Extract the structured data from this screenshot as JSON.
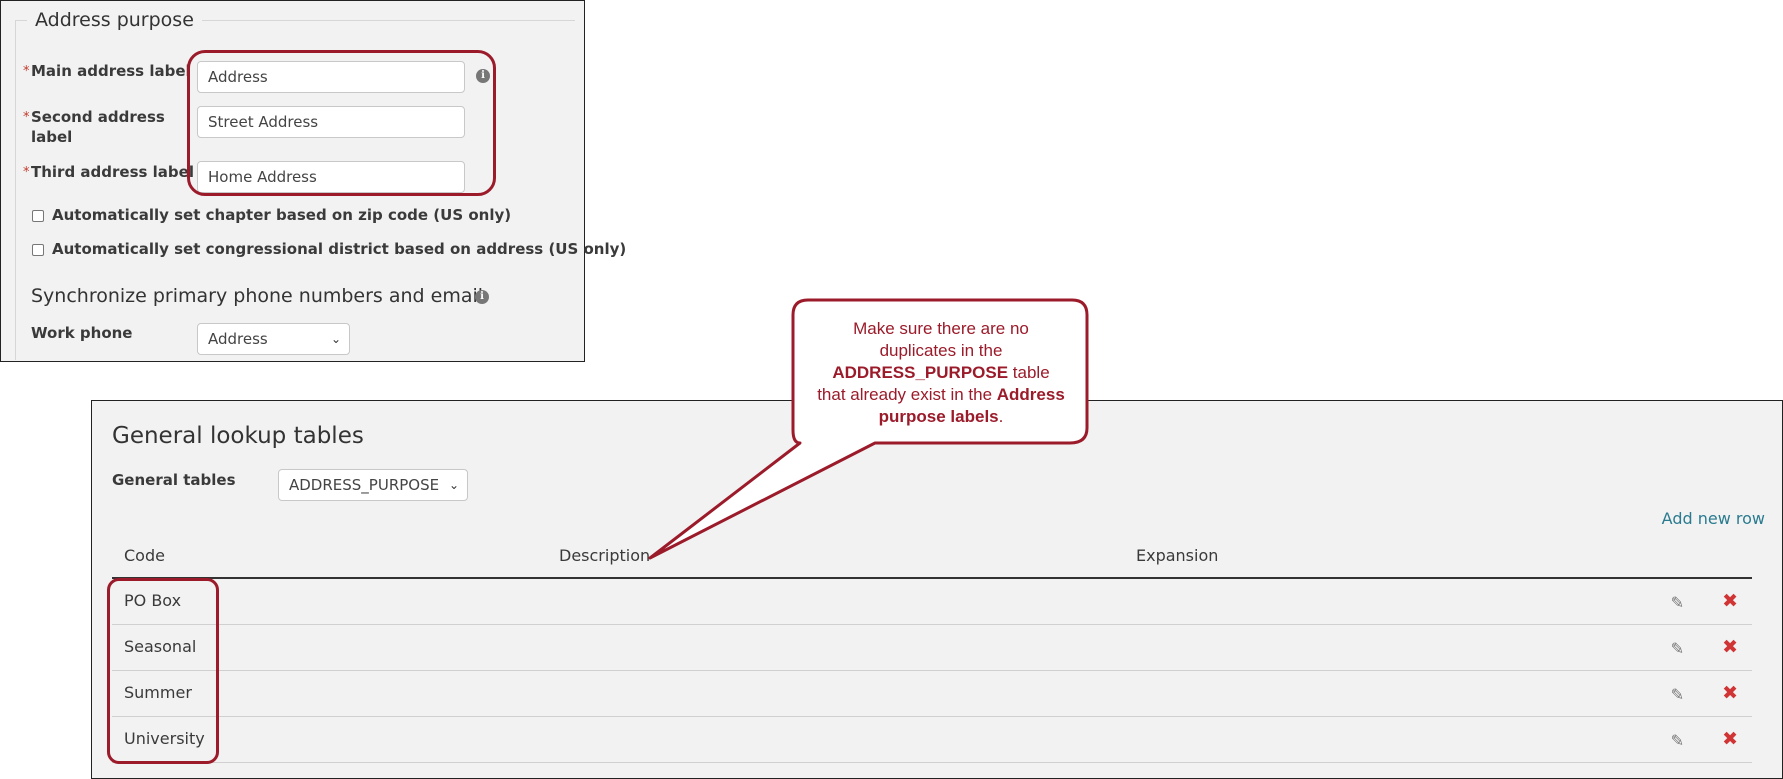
{
  "address_purpose": {
    "legend": "Address purpose",
    "fields": [
      {
        "label": "Main address label",
        "value": "Address"
      },
      {
        "label_line1": "Second address",
        "label_line2": "label",
        "value": "Street Address"
      },
      {
        "label": "Third address label",
        "value": "Home Address"
      }
    ],
    "required_mark": "*",
    "checkboxes": [
      {
        "label": "Automatically set chapter based on zip code (US only)",
        "checked": false
      },
      {
        "label": "Automatically set congressional district based on address (US only)",
        "checked": false
      }
    ],
    "sync_heading": "Synchronize primary phone numbers and email",
    "work_phone": {
      "label": "Work phone",
      "selected": "Address"
    }
  },
  "lookup_tables": {
    "title": "General lookup tables",
    "general_tables_label": "General tables",
    "general_tables_selected": "ADDRESS_PURPOSE",
    "add_new_row": "Add new row",
    "columns": [
      "Code",
      "Description",
      "Expansion"
    ],
    "rows": [
      {
        "code": "PO Box"
      },
      {
        "code": "Seasonal"
      },
      {
        "code": "Summer"
      },
      {
        "code": "University"
      }
    ]
  },
  "callout": {
    "line1": "Make sure there are no",
    "line2": "duplicates in the",
    "bold1": "ADDRESS_PURPOSE",
    "text_after_bold1": " table",
    "line4_prefix": "that already exist in the ",
    "bold2": "Address purpose labels",
    "period": "."
  },
  "colors": {
    "annotation": "#9b1b2a",
    "link": "#2a7b8f",
    "delete": "#d03434",
    "panel_bg": "#f2f2f2"
  },
  "icons": {
    "info": "info-icon",
    "edit": "pencil-icon",
    "delete": "close-x-icon",
    "dropdown": "chevron-down-icon"
  }
}
